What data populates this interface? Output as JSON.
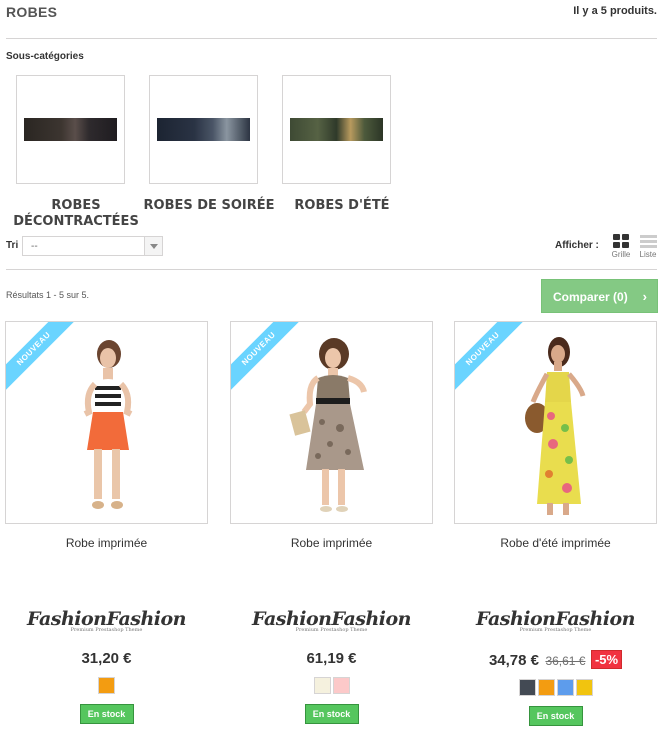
{
  "header": {
    "title": "ROBES",
    "count": "Il y a 5 produits."
  },
  "subcategories": {
    "heading": "Sous-catégories",
    "items": [
      {
        "name": "ROBES DÉCONTRACTÉES"
      },
      {
        "name": "ROBES DE SOIRÉE"
      },
      {
        "name": "ROBES D'ÉTÉ"
      }
    ]
  },
  "sort": {
    "label": "Tri",
    "value": "--"
  },
  "view": {
    "label": "Afficher :",
    "grid": "Grille",
    "list": "Liste"
  },
  "results": "Résultats 1 - 5 sur 5.",
  "compare": {
    "label": "Comparer (0)",
    "chevron": "›",
    "color": "#5cb85c"
  },
  "products": [
    {
      "badge": "NOUVEAU",
      "name": "Robe imprimée",
      "brand": "FashionFashion",
      "brand_tag": "Premium Prestashop Theme",
      "price": "31,20 €",
      "old_price": "",
      "reduction": "",
      "colors": [
        "#f39c11"
      ],
      "stock": "En stock"
    },
    {
      "badge": "NOUVEAU",
      "name": "Robe imprimée",
      "brand": "FashionFashion",
      "brand_tag": "Premium Prestashop Theme",
      "price": "61,19 €",
      "old_price": "",
      "reduction": "",
      "colors": [
        "#f5f1de",
        "#fcc9c9"
      ],
      "stock": "En stock"
    },
    {
      "badge": "NOUVEAU",
      "name": "Robe d'été imprimée",
      "brand": "FashionFashion",
      "brand_tag": "Premium Prestashop Theme",
      "price": "34,78 €",
      "old_price": "36,61 €",
      "reduction": "-5%",
      "colors": [
        "#434a54",
        "#f39c11",
        "#5d9cec",
        "#f1c40f"
      ],
      "stock": "En stock"
    }
  ]
}
